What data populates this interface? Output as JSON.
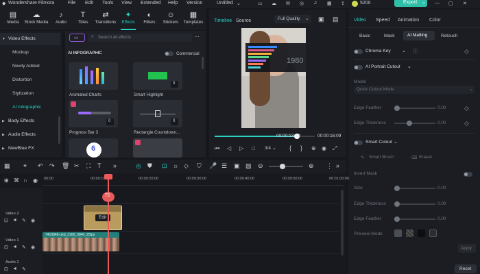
{
  "titlebar": {
    "app_name": "Wondershare Filmora",
    "menus": [
      "File",
      "Edit",
      "Tools",
      "View",
      "Extended",
      "Help",
      "Version"
    ],
    "doc_title": "Untitled",
    "credits": "5200",
    "export_label": "Export"
  },
  "toolbar": {
    "tabs": [
      {
        "label": "Media",
        "icon": "media-icon",
        "glyph": "▤"
      },
      {
        "label": "Stock Media",
        "icon": "stock-media-icon",
        "glyph": "☁"
      },
      {
        "label": "Audio",
        "icon": "audio-icon",
        "glyph": "♪"
      },
      {
        "label": "Titles",
        "icon": "titles-icon",
        "glyph": "T"
      },
      {
        "label": "Transitions",
        "icon": "transitions-icon",
        "glyph": "⇄"
      },
      {
        "label": "Effects",
        "icon": "effects-icon",
        "glyph": "✦"
      },
      {
        "label": "Filters",
        "icon": "filters-icon",
        "glyph": "◐"
      },
      {
        "label": "Stickers",
        "icon": "stickers-icon",
        "glyph": "☺"
      },
      {
        "label": "Templates",
        "icon": "templates-icon",
        "glyph": "▦"
      }
    ],
    "active_index": 5
  },
  "sidebar": {
    "items": [
      {
        "label": "Video Effects",
        "type": "group",
        "caret": "▼"
      },
      {
        "label": "Mockup",
        "type": "item"
      },
      {
        "label": "Newly Added",
        "type": "item"
      },
      {
        "label": "Distortion",
        "type": "item"
      },
      {
        "label": "Stylization",
        "type": "item"
      },
      {
        "label": "AI Infographic",
        "type": "selected"
      },
      {
        "label": "Body Effects",
        "type": "group",
        "caret": "▶"
      },
      {
        "label": "Audio Effects",
        "type": "group",
        "caret": "▶"
      },
      {
        "label": "NewBlue FX",
        "type": "group",
        "caret": "▶"
      }
    ]
  },
  "effects": {
    "search_placeholder": "Search all effects",
    "section_title": "AI INFOGRAPHIC",
    "commercial_label": "Commercial",
    "cards": [
      {
        "label": "Animated Charts",
        "badge": ""
      },
      {
        "label": "Smart Highlight",
        "badge": "0"
      },
      {
        "label": "Progress Bar 3",
        "badge": "0"
      },
      {
        "label": "Rectangle Countdown...",
        "badge": "0"
      }
    ]
  },
  "preview": {
    "tab_timeline": "Timeline",
    "tab_source": "Source",
    "quality": "Full Quality",
    "overlay_year": "1980",
    "current_time": "00:00:13:13",
    "total_time": "00:00:16:09",
    "playback_progress": 0.82,
    "ratio": "3/4"
  },
  "rightpanel": {
    "tabs": [
      "Video",
      "Speed",
      "Animation",
      "Color"
    ],
    "active_tab": "Video",
    "subtabs": [
      "Basic",
      "Mask",
      "AI Matting",
      "Retouch"
    ],
    "active_subtab": "AI Matting",
    "chroma_key": "Chroma Key",
    "ai_portrait": "AI Portrait Cutout",
    "model_label": "Model",
    "model_value": "Quick Cutout Mode",
    "edge_feather": "Edge Feather",
    "edge_thickness": "Edge Thickness",
    "zero": "0.00",
    "smart_cutout": "Smart Cutout",
    "smart_brush": "Smart Brush",
    "eraser": "Eraser",
    "invert_mask": "Invert Mask",
    "size": "Size",
    "edge_thickness2": "Edge Thickness",
    "edge_feather2": "Edge Feather",
    "preview_mode": "Preview Mode",
    "apply": "Apply",
    "reset": "Reset"
  },
  "timeline": {
    "ruler": [
      "00:00",
      "00:00:10:00",
      "00:00:20:00",
      "00:00:30:00",
      "00:00:40:00",
      "00:00:50:00",
      "00:01:00:00"
    ],
    "playhead_label": "T5",
    "tracks": [
      {
        "name": "Video 2"
      },
      {
        "name": "Video 1"
      },
      {
        "name": "Audio 1"
      }
    ],
    "effect_clip_label": "Edit",
    "video_clip_label": "7410848-uhd_2160_3840_25fps"
  },
  "colors": {
    "accent": "#28d3c6",
    "export": "#2fbfa8",
    "playhead": "#ee5a5a"
  }
}
